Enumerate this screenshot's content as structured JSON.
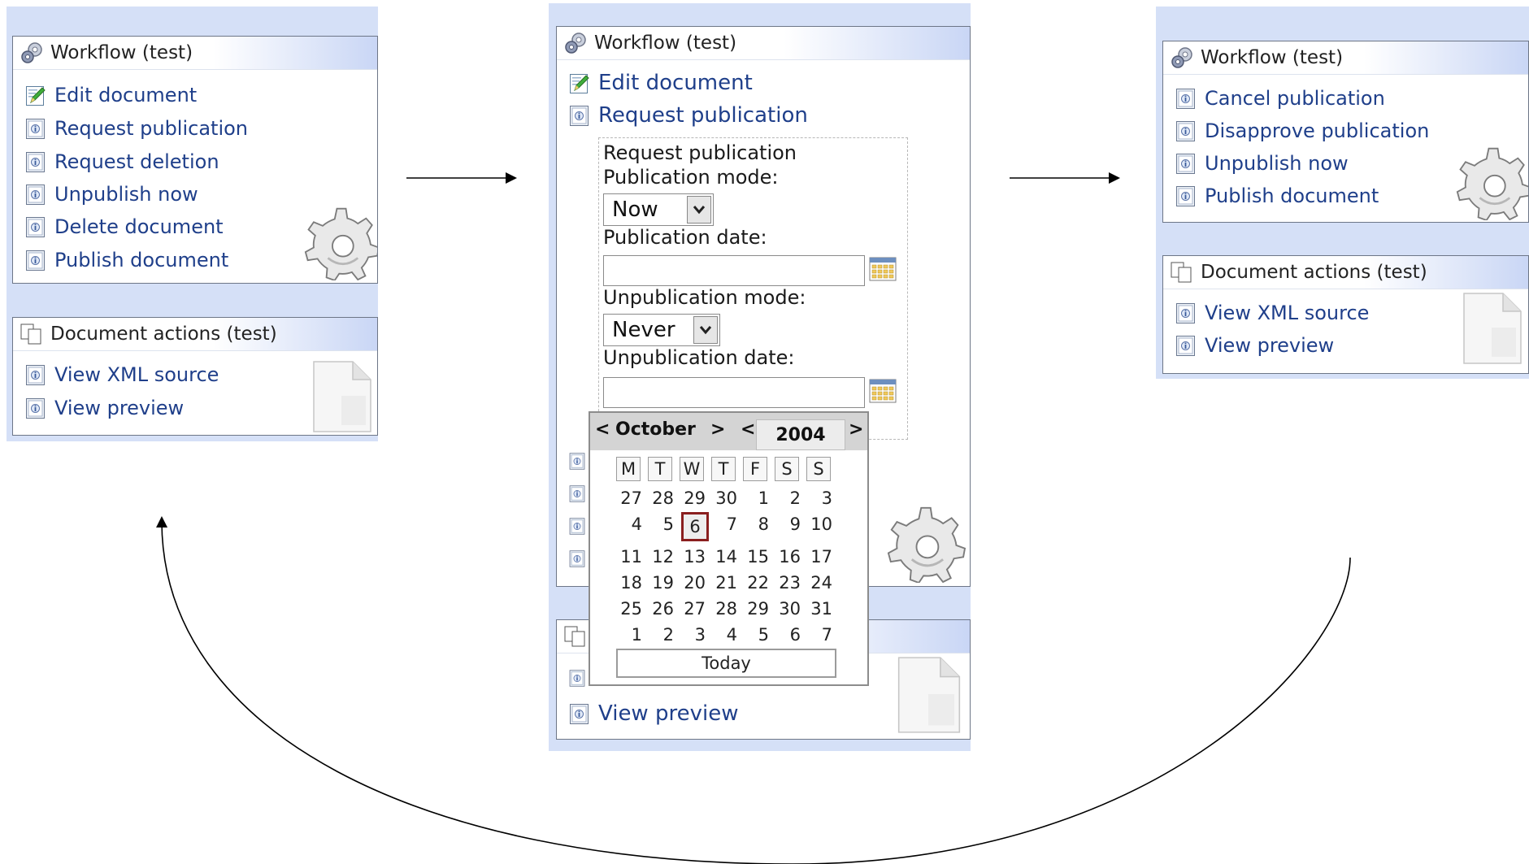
{
  "panels": [
    {
      "workflow": {
        "title": "Workflow (test)",
        "items": [
          "Edit document",
          "Request publication",
          "Request deletion",
          "Unpublish now",
          "Delete document",
          "Publish document"
        ]
      },
      "actions": {
        "title": "Document actions (test)",
        "items": [
          "View XML source",
          "View preview"
        ]
      }
    },
    {
      "workflow": {
        "title": "Workflow (test)",
        "items": [
          "Edit document",
          "Request publication"
        ]
      },
      "form": {
        "heading": "Request publication",
        "publication_mode_label": "Publication mode:",
        "publication_mode_value": "Now",
        "publication_date_label": "Publication date:",
        "publication_date_value": "",
        "unpublication_mode_label": "Unpublication mode:",
        "unpublication_mode_value": "Never",
        "unpublication_date_label": "Unpublication date:",
        "unpublication_date_value": ""
      },
      "calendar": {
        "prev_month": "<",
        "month": "October",
        "next_month": ">",
        "prev_year": "<",
        "year": "2004",
        "next_year": ">",
        "weekdays": [
          "M",
          "T",
          "W",
          "T",
          "F",
          "S",
          "S"
        ],
        "weeks": [
          [
            "27",
            "28",
            "29",
            "30",
            "1",
            "2",
            "3"
          ],
          [
            "4",
            "5",
            "6",
            "7",
            "8",
            "9",
            "10"
          ],
          [
            "11",
            "12",
            "13",
            "14",
            "15",
            "16",
            "17"
          ],
          [
            "18",
            "19",
            "20",
            "21",
            "22",
            "23",
            "24"
          ],
          [
            "25",
            "26",
            "27",
            "28",
            "29",
            "30",
            "31"
          ],
          [
            "1",
            "2",
            "3",
            "4",
            "5",
            "6",
            "7"
          ]
        ],
        "selected_day": "6",
        "today_label": "Today"
      },
      "actions": {
        "items": [
          "View preview"
        ]
      }
    },
    {
      "workflow": {
        "title": "Workflow (test)",
        "items": [
          "Cancel publication",
          "Disapprove publication",
          "Unpublish now",
          "Publish document"
        ]
      },
      "actions": {
        "title": "Document actions (test)",
        "items": [
          "View XML source",
          "View preview"
        ]
      }
    }
  ],
  "colors": {
    "panel_bg": "#d5e0f7",
    "link": "#1f3f8a",
    "border": "#6d7687",
    "selected_day_border": "#8a1f1f"
  },
  "icons": {
    "workflow_header": "gears-icon",
    "actions_header": "copy-pages-icon",
    "edit": "edit-pencil-icon",
    "doc": "info-document-icon",
    "gear": "gear-icon",
    "paper": "blank-page-icon",
    "calendar": "calendar-icon"
  }
}
